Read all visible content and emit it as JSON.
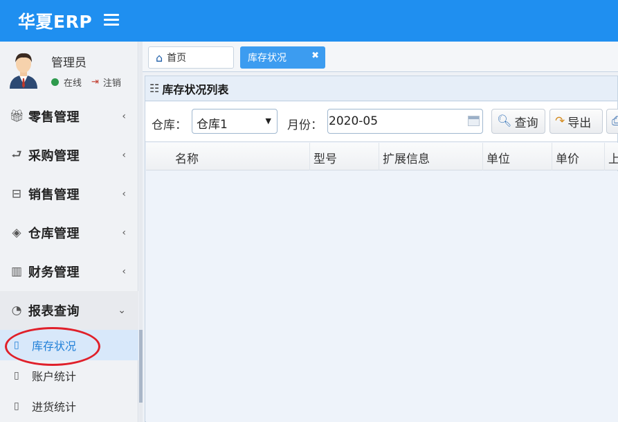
{
  "header": {
    "logo": "华夏ERP"
  },
  "user": {
    "name": "管理员",
    "status": "在线",
    "logout": "注销"
  },
  "sidebar": {
    "items": [
      {
        "label": "零售管理",
        "icon": "gift-icon"
      },
      {
        "label": "采购管理",
        "icon": "cart-icon"
      },
      {
        "label": "销售管理",
        "icon": "briefcase-icon"
      },
      {
        "label": "仓库管理",
        "icon": "layers-icon"
      },
      {
        "label": "财务管理",
        "icon": "book-icon"
      },
      {
        "label": "报表查询",
        "icon": "pie-icon",
        "expanded": true
      }
    ],
    "sub_items": [
      {
        "label": "库存状况",
        "active": true
      },
      {
        "label": "账户统计"
      },
      {
        "label": "进货统计"
      }
    ]
  },
  "tabs": [
    {
      "label": "首页",
      "icon": "home-icon"
    },
    {
      "label": "库存状况",
      "active": true,
      "close": "✖"
    }
  ],
  "panel": {
    "title": "库存状况列表",
    "warehouse_label": "仓库：",
    "warehouse_value": "仓库1",
    "month_label": "月份：",
    "month_value": "2020-05",
    "query_button": "查询",
    "export_button": "导出"
  },
  "table": {
    "columns": [
      "名称",
      "型号",
      "扩展信息",
      "单位",
      "单价",
      "上"
    ]
  },
  "colors": {
    "header_bg": "#1f8ff0",
    "active_tab": "#3c9cf0",
    "highlight": "#e0202a"
  }
}
